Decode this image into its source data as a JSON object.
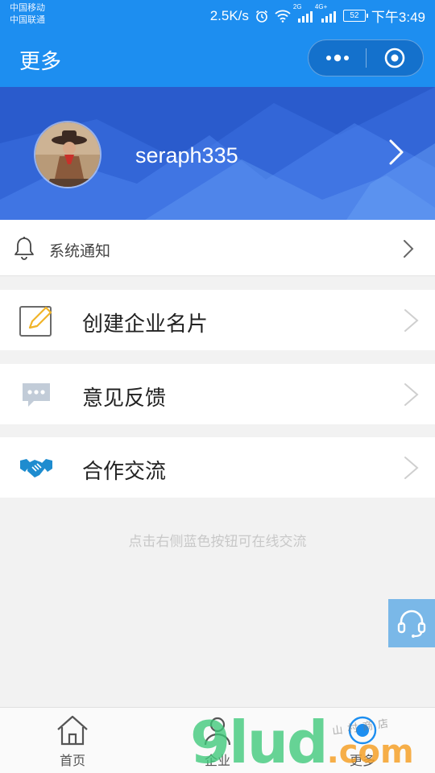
{
  "status_bar": {
    "carrier_1": "中国移动",
    "carrier_2": "中国联通",
    "speed": "2.5K/s",
    "network_1": "2G",
    "network_2": "4G+",
    "battery": "52",
    "time": "下午3:49"
  },
  "nav": {
    "title": "更多",
    "icons": [
      "more-dots-icon",
      "close-target-icon"
    ]
  },
  "profile": {
    "username": "seraph335"
  },
  "notice": {
    "label": "系统通知",
    "icon": "bell-icon"
  },
  "menu": [
    {
      "label": "创建企业名片",
      "icon": "edit-card-icon"
    },
    {
      "label": "意见反馈",
      "icon": "chat-bubble-icon"
    },
    {
      "label": "合作交流",
      "icon": "handshake-icon"
    }
  ],
  "hint": "点击右侧蓝色按钮可在线交流",
  "service_icon": "headset-icon",
  "tabs": [
    {
      "label": "首页",
      "icon": "home-icon"
    },
    {
      "label": "企业",
      "icon": "user-icon"
    },
    {
      "label": "更多",
      "icon": "more-icon",
      "active": true
    }
  ],
  "watermark": {
    "main": "9lud",
    "suffix": ".com",
    "sub": "山村商店"
  },
  "colors": {
    "header_blue": "#1d8ef0",
    "banner_blue": "#2a57c8",
    "service_blue": "#7ab8e8",
    "edit_icon_yellow": "#f0b429",
    "handshake_blue": "#1e8ccf"
  }
}
